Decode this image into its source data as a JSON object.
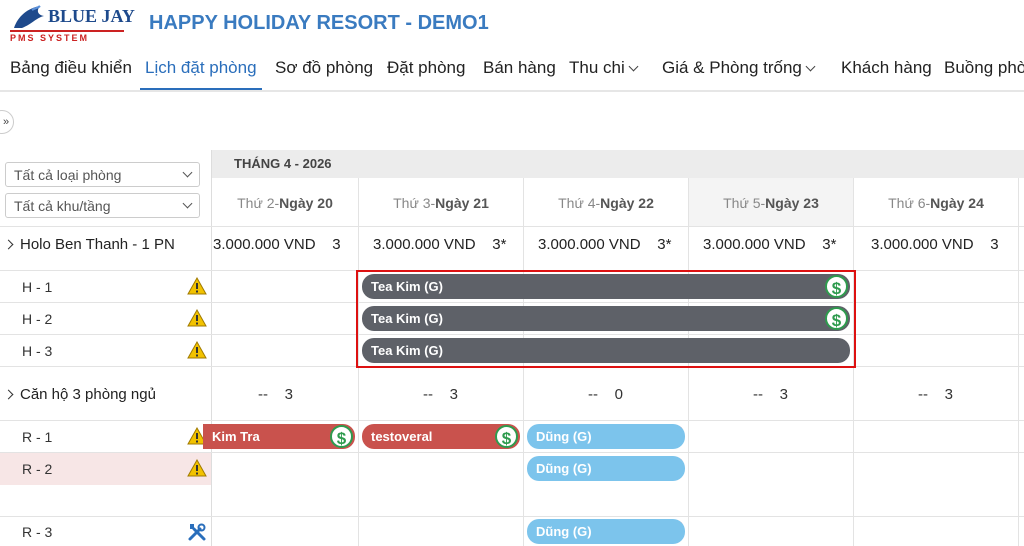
{
  "app": {
    "logo_main": "BLUE JAY",
    "logo_sub": "PMS SYSTEM",
    "title": "HAPPY HOLIDAY RESORT - DEMO1"
  },
  "nav": [
    {
      "label": "Bảng điều khiển"
    },
    {
      "label": "Lịch đặt phòng",
      "active": true
    },
    {
      "label": "Sơ đồ phòng"
    },
    {
      "label": "Đặt phòng"
    },
    {
      "label": "Bán hàng"
    },
    {
      "label": "Thu chi",
      "dropdown": true
    },
    {
      "label": "Giá & Phòng trống",
      "dropdown": true
    },
    {
      "label": "Khách hàng"
    },
    {
      "label": "Buồng phò"
    }
  ],
  "expand_label": "»",
  "filters": {
    "room_type": "Tất cả loại phòng",
    "area": "Tất cả khu/tầng"
  },
  "month_label": "THÁNG 4 - 2026",
  "days": [
    {
      "prefix": "Thứ 2-",
      "day": "Ngày 20"
    },
    {
      "prefix": "Thứ 3-",
      "day": "Ngày 21"
    },
    {
      "prefix": "Thứ 4-",
      "day": "Ngày 22"
    },
    {
      "prefix": "Thứ 5-",
      "day": "Ngày 23"
    },
    {
      "prefix": "Thứ 6-",
      "day": "Ngày 24"
    }
  ],
  "groups": [
    {
      "name": "Holo Ben Thanh - 1 PN",
      "prices": [
        {
          "amount": "3.000.000 VND",
          "count": "3"
        },
        {
          "amount": "3.000.000 VND",
          "count": "3*"
        },
        {
          "amount": "3.000.000 VND",
          "count": "3*"
        },
        {
          "amount": "3.000.000 VND",
          "count": "3*"
        },
        {
          "amount": "3.000.000 VND",
          "count": "3"
        }
      ],
      "rooms": [
        "H - 1",
        "H - 2",
        "H - 3"
      ]
    },
    {
      "name": "Căn hộ 3 phòng ngủ",
      "availability": [
        {
          "dash": "--",
          "count": "3"
        },
        {
          "dash": "--",
          "count": "3"
        },
        {
          "dash": "--",
          "count": "0"
        },
        {
          "dash": "--",
          "count": "3"
        },
        {
          "dash": "--",
          "count": "3"
        }
      ],
      "rooms": [
        "R - 1",
        "R - 2",
        "R - 3"
      ]
    }
  ],
  "bookings": {
    "h1": {
      "guest": "Tea Kim (G)",
      "paid_icon": "$"
    },
    "h2": {
      "guest": "Tea Kim (G)",
      "paid_icon": "$"
    },
    "h3": {
      "guest": "Tea Kim (G)"
    },
    "r1a": {
      "guest": "Kim Tra",
      "paid_icon": "$"
    },
    "r1b": {
      "guest": "testoveral",
      "paid_icon": "$"
    },
    "r1c": {
      "guest": "Dũng (G)"
    },
    "r2": {
      "guest": "Dũng (G)"
    },
    "r3": {
      "guest": "Dũng (G)"
    }
  },
  "colors": {
    "accent": "#2a6ebb",
    "booking_gray": "#5e6168",
    "booking_red": "#c9524d",
    "booking_blue": "#7cc4ec",
    "highlight_border": "#d11"
  }
}
